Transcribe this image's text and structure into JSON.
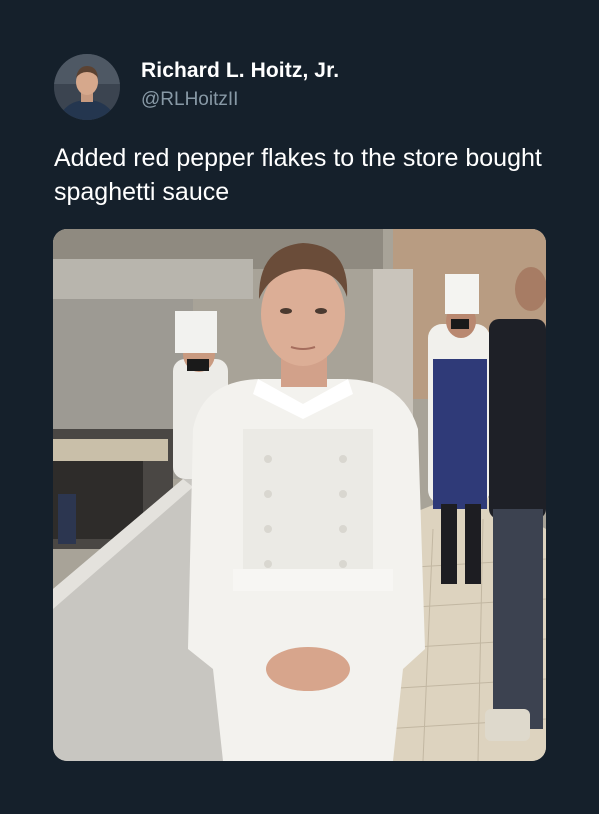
{
  "author": {
    "display_name": "Richard L. Hoitz, Jr.",
    "handle": "@RLHoitzII"
  },
  "tweet": {
    "text": "Added red pepper flakes to the store bought spaghetti sauce"
  },
  "media": {
    "type": "photo",
    "subject": "chef-in-white-jacket-in-kitchen"
  },
  "colors": {
    "background": "#15202b",
    "text_primary": "#ffffff",
    "text_secondary": "#8899a6"
  }
}
